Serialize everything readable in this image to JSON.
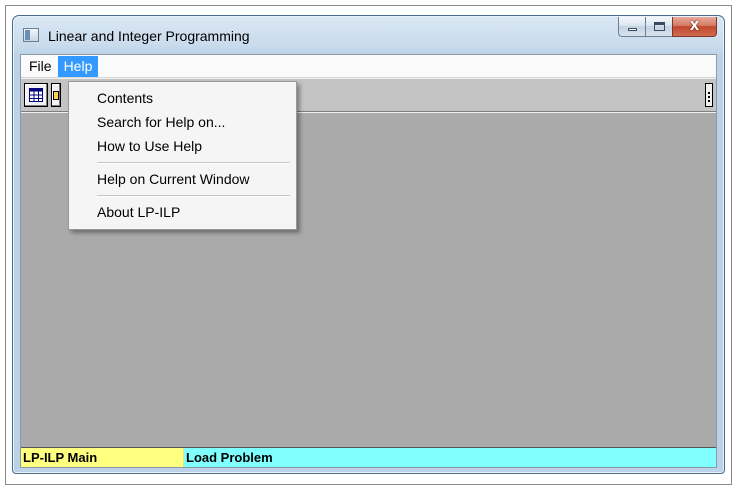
{
  "window": {
    "title": "Linear and Integer Programming",
    "close_glyph": "X",
    "icons": [
      "app-icon",
      "minimize-icon",
      "maximize-icon",
      "close-icon"
    ]
  },
  "menu_bar": {
    "items": [
      {
        "label": "File",
        "active": false
      },
      {
        "label": "Help",
        "active": true
      }
    ]
  },
  "help_menu": {
    "items": [
      {
        "label": "Contents"
      },
      {
        "label": "Search for Help on..."
      },
      {
        "label": "How to Use Help"
      },
      {
        "label": "Help on Current Window"
      },
      {
        "label": "About LP-ILP"
      }
    ]
  },
  "toolbar": {
    "icons": [
      "grid-icon",
      "folder-icon",
      "toolbar-grip-icon"
    ]
  },
  "status_bar": {
    "left": "LP-ILP Main",
    "right": "Load Problem"
  },
  "colors": {
    "menu_highlight": "#3399ff",
    "workspace": "#aaaaaa",
    "status_left": "#ffff80",
    "status_right": "#80ffff"
  }
}
